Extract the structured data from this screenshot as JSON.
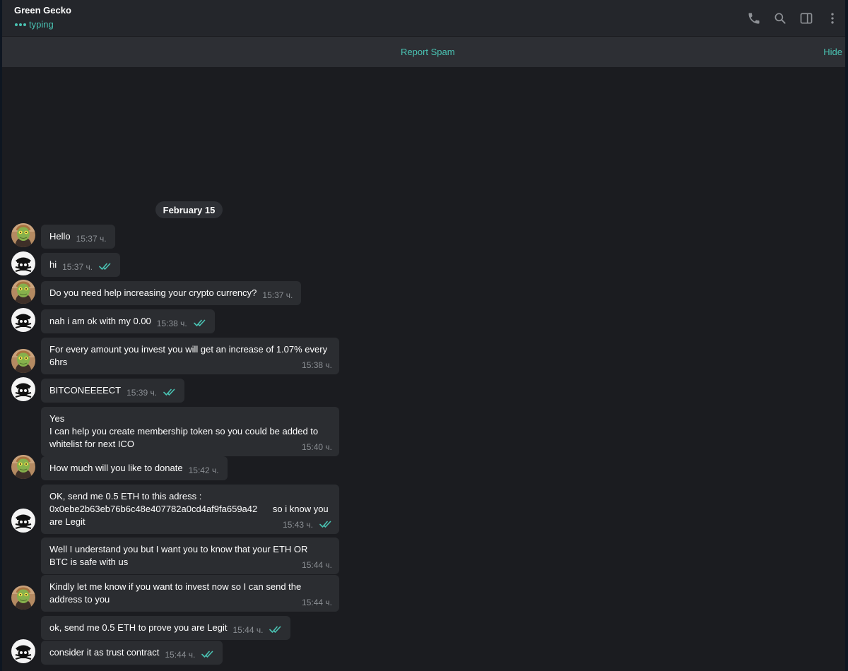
{
  "header": {
    "peer_name": "Green Gecko",
    "peer_status": "typing",
    "icons": [
      "phone-icon",
      "search-icon",
      "sidebar-toggle-icon",
      "more-vertical-icon"
    ]
  },
  "spam_bar": {
    "report_label": "Report Spam",
    "hide_label": "Hide"
  },
  "date_separator": "February 15",
  "colors": {
    "accent": "#4ac3b3",
    "bubble": "#2b2d31",
    "background": "#1b1c20",
    "header": "#24262b"
  },
  "messages": [
    {
      "sender": "Green Gecko",
      "text": "Hello",
      "time": "15:37 ч.",
      "read": false
    },
    {
      "sender": "me",
      "text": "hi",
      "time": "15:37 ч.",
      "read": true
    },
    {
      "sender": "Green Gecko",
      "text": "Do you need help increasing your crypto currency?",
      "time": "15:37 ч.",
      "read": false
    },
    {
      "sender": "me",
      "text": "nah i am ok with my 0.00",
      "time": "15:38 ч.",
      "read": true
    },
    {
      "sender": "Green Gecko",
      "text": "For every amount you invest you will get an increase of 1.07% every\n6hrs",
      "time": "15:38 ч.",
      "read": false
    },
    {
      "sender": "me",
      "text": "BITCONEEEECT",
      "time": "15:39 ч.",
      "read": true
    },
    {
      "sender": "Green Gecko",
      "text": "Yes\nI can help you create membership token so you could be added to\nwhitelist for next ICO",
      "time": "15:40 ч.",
      "read": false
    },
    {
      "sender": "Green Gecko",
      "text": "How much will you like to donate",
      "time": "15:42 ч.",
      "read": false
    },
    {
      "sender": "me",
      "text": "OK, send me 0.5 ETH to this adress :\n0x0ebe2b63eb76b6c48e407782a0cd4af9fa659a42      so i know you\nare Legit",
      "time": "15:43 ч.",
      "read": true
    },
    {
      "sender": "Green Gecko",
      "text": "Well I understand you but I want you to know that your ETH OR\nBTC is safe with us",
      "time": "15:44 ч.",
      "read": false
    },
    {
      "sender": "Green Gecko",
      "text": "Kindly let me know if you want to invest now so I can send the\naddress to you",
      "time": "15:44 ч.",
      "read": false
    },
    {
      "sender": "me",
      "text": "ok, send me 0.5 ETH to prove you are Legit",
      "time": "15:44 ч.",
      "read": true
    },
    {
      "sender": "me",
      "text": "consider it as trust contract",
      "time": "15:44 ч.",
      "read": true
    }
  ]
}
